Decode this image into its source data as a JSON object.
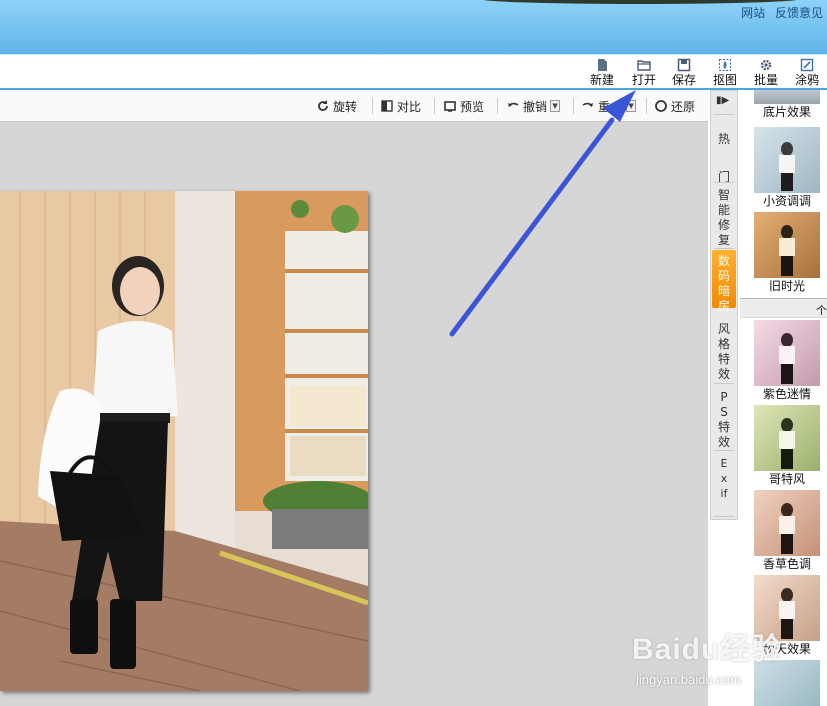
{
  "titlebar": {
    "links": [
      "网站",
      "反馈意见"
    ]
  },
  "main_toolbar": {
    "items": [
      {
        "label": "新建",
        "icon": "new-file-icon"
      },
      {
        "label": "打开",
        "icon": "open-folder-icon"
      },
      {
        "label": "保存",
        "icon": "save-disk-icon"
      },
      {
        "label": "抠图",
        "icon": "cutout-icon"
      },
      {
        "label": "批量",
        "icon": "batch-gear-icon"
      },
      {
        "label": "涂鸦",
        "icon": "doodle-icon"
      }
    ]
  },
  "sub_toolbar": {
    "rotate": "旋转",
    "compare": "对比",
    "preview": "预览",
    "undo": "撤销",
    "redo": "重",
    "restore": "还原"
  },
  "vertical_tabs": {
    "items": [
      {
        "label": "热门",
        "active": false
      },
      {
        "label": "智能修复",
        "active": false
      },
      {
        "label": "数码暗房",
        "active": true
      },
      {
        "label": "风格特效",
        "active": false
      },
      {
        "label": "PS特效",
        "active": false
      },
      {
        "label": "Exif",
        "active": false
      }
    ]
  },
  "effects": {
    "top": [
      {
        "name": "底片效果"
      },
      {
        "name": "小资调调"
      },
      {
        "name": "旧时光"
      }
    ],
    "separator_label": "个",
    "bottom": [
      {
        "name": "紫色迷情"
      },
      {
        "name": "哥特风"
      },
      {
        "name": "香草色调"
      },
      {
        "name": "秋天效果"
      }
    ]
  },
  "watermark": {
    "main": "Baidu经验",
    "url": "jingyan.baidu.com"
  },
  "colors": {
    "title_bar": "#6dbdee",
    "toolbar_border": "#49a6e3",
    "arrow": "#3a56d6",
    "active_tab": "#f59400"
  }
}
